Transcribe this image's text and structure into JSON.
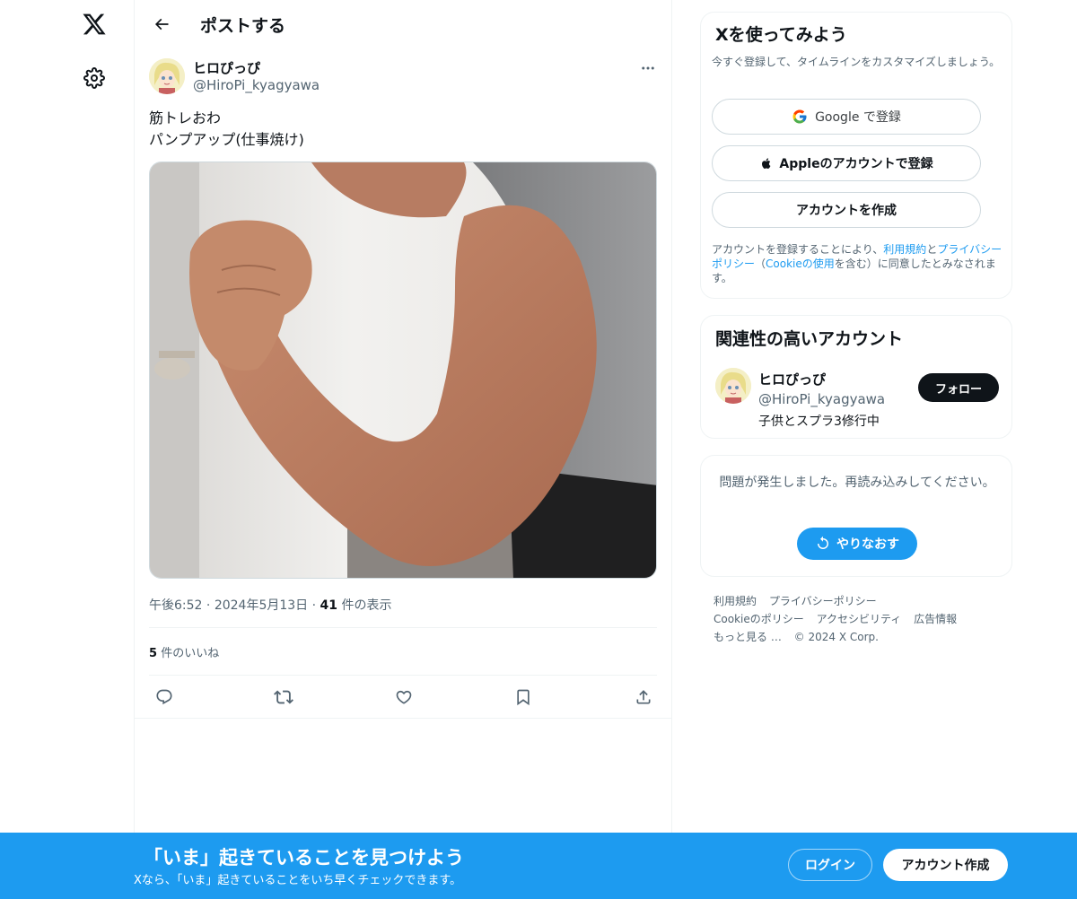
{
  "nav": {
    "logo_icon": "x-logo-icon",
    "settings_icon": "gear-icon"
  },
  "header": {
    "title": "ポストする"
  },
  "post": {
    "author_name": "ヒロぴっぴ",
    "author_handle": "@HiroPi_kyagyawa",
    "text_lines": [
      "筋トレおわ",
      "パンプアップ(仕事焼け)"
    ],
    "time": "午後6:52",
    "date": "2024年5月13日",
    "views_count": "41",
    "views_label": "件の表示",
    "likes_count": "5",
    "likes_label": "件のいいね",
    "media_alt": "flexed arm photo"
  },
  "signup_card": {
    "title": "Xを使ってみよう",
    "subtitle": "今すぐ登録して、タイムラインをカスタマイズしましょう。",
    "google_label": "Google で登録",
    "apple_label": "Appleのアカウントで登録",
    "create_label": "アカウントを作成",
    "terms_prefix": "アカウントを登録することにより、",
    "terms_link": "利用規約",
    "terms_and": "と",
    "privacy_link": "プライバシーポリシー",
    "cookie_open": "（",
    "cookie_link": "Cookieの使用",
    "cookie_rest": "を含む）に同意したとみなされます。"
  },
  "related": {
    "title": "関連性の高いアカウント",
    "name": "ヒロぴっぴ",
    "handle": "@HiroPi_kyagyawa",
    "bio": "子供とスプラ3修行中",
    "follow_label": "フォロー"
  },
  "error_card": {
    "message": "問題が発生しました。再読み込みしてください。",
    "retry_label": "やりなおす"
  },
  "footer": {
    "links_row1": [
      "利用規約",
      "プライバシーポリシー"
    ],
    "links_row2": [
      "Cookieのポリシー",
      "アクセシビリティ",
      "広告情報"
    ],
    "more": "もっと見る …",
    "copyright": "© 2024 X Corp."
  },
  "banner": {
    "title": "「いま」起きていることを見つけよう",
    "subtitle": "Xなら、「いま」起きていることをいち早くチェックできます。",
    "login_label": "ログイン",
    "signup_label": "アカウント作成"
  },
  "colors": {
    "accent": "#1d9bf0",
    "text": "#0f1419",
    "muted": "#536471",
    "border": "#eff3f4"
  }
}
